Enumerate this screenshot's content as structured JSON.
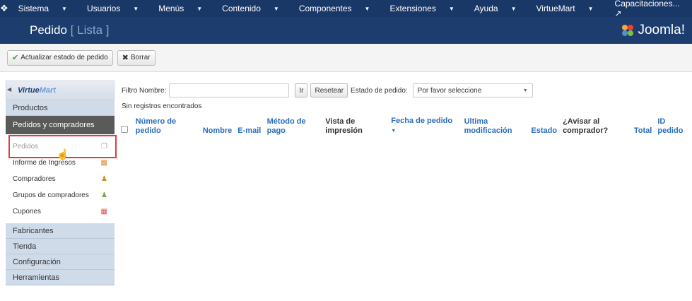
{
  "navbar": {
    "brand_icon": "joomla-icon",
    "menus": [
      "Sistema",
      "Usuarios",
      "Menús",
      "Contenido",
      "Componentes",
      "Extensiones",
      "Ayuda",
      "VirtueMart"
    ],
    "user_site": "Capacitaciones...",
    "settings_icon": "gear-icon"
  },
  "header": {
    "title": "Pedido",
    "subtitle": "[ Lista ]",
    "logo_text": "Joomla!"
  },
  "toolbar": {
    "update_status_label": "Actualizar estado de pedido",
    "delete_label": "Borrar"
  },
  "sidebar": {
    "logo_text_a": "Virtue",
    "logo_text_b": "Mart",
    "sections": {
      "productos": "Productos",
      "pedidos_compradores": "Pedidos y compradores",
      "fabricantes": "Fabricantes",
      "tienda": "Tienda",
      "configuracion": "Configuración",
      "herramientas": "Herramientas"
    },
    "sub_items": [
      "Pedidos",
      "Informe de Ingresos",
      "Compradores",
      "Grupos de compradores",
      "Cupones"
    ]
  },
  "filter": {
    "label": "Filtro Nombre:",
    "value": "",
    "go_label": "Ir",
    "reset_label": "Resetear",
    "status_label": "Estado de pedido:",
    "status_select": "Por favor seleccione"
  },
  "messages": {
    "no_records": "Sin registros encontrados"
  },
  "table": {
    "columns": [
      "Número de pedido",
      "Nombre",
      "E-mail",
      "Método de pago",
      "Vista de impresión",
      "Fecha de pedido",
      "Ultima modificación",
      "Estado",
      "¿Avisar al comprador?",
      "Total",
      "ID pedido"
    ]
  }
}
